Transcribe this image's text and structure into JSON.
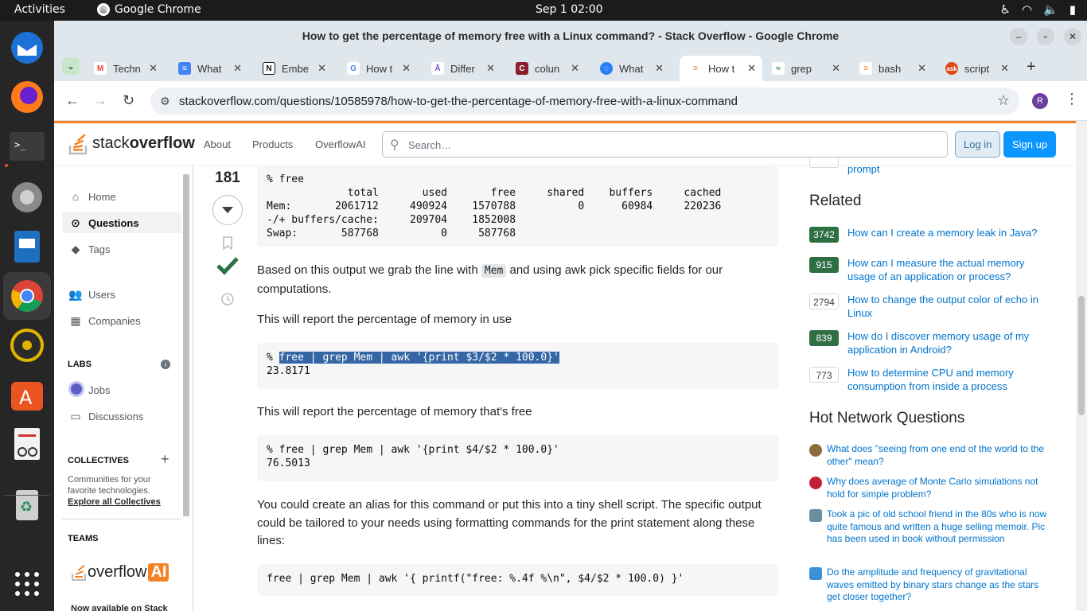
{
  "topbar": {
    "activities": "Activities",
    "app_name": "Google Chrome",
    "clock": "Sep 1  02:00"
  },
  "window": {
    "title": "How to get the percentage of memory free with a Linux command? - Stack Overflow - Google Chrome"
  },
  "tabs": [
    {
      "label": "Techn",
      "favicon": "gmail-icon",
      "color": "#ea4335"
    },
    {
      "label": "What",
      "favicon": "docs-icon",
      "color": "#4285f4"
    },
    {
      "label": "Embe",
      "favicon": "notion-icon",
      "color": "#111111"
    },
    {
      "label": "How t",
      "favicon": "google-icon",
      "color": "#4285f4"
    },
    {
      "label": "Differ",
      "favicon": "ask-ubuntu-icon",
      "color": "#6e56cf"
    },
    {
      "label": "colun",
      "favicon": "column-icon",
      "color": "#8b1d2c"
    },
    {
      "label": "What",
      "favicon": "search-icon",
      "color": "#2d7ff9"
    },
    {
      "label": "How t",
      "favicon": "stackoverflow-icon",
      "color": "#f48225",
      "active": true
    },
    {
      "label": "grep",
      "favicon": "grep-icon",
      "color": "#2e8b57"
    },
    {
      "label": "bash",
      "favicon": "stackoverflow-icon",
      "color": "#f48225"
    },
    {
      "label": "script",
      "favicon": "askubuntu-icon",
      "color": "#dd4814"
    }
  ],
  "address_bar": {
    "url": "stackoverflow.com/questions/10585978/how-to-get-the-percentage-of-memory-free-with-a-linux-command",
    "profile_initial": "R"
  },
  "so_header": {
    "logo_stack": "stack",
    "logo_overflow": "overflow",
    "nav": [
      "About",
      "Products",
      "OverflowAI"
    ],
    "search_placeholder": "Search…",
    "login": "Log in",
    "signup": "Sign up"
  },
  "left_nav": {
    "home": "Home",
    "questions": "Questions",
    "tags": "Tags",
    "users": "Users",
    "companies": "Companies",
    "labs_heading": "LABS",
    "jobs": "Jobs",
    "discussions": "Discussions",
    "collectives_heading": "COLLECTIVES",
    "collectives_desc": "Communities for your favorite technologies.",
    "collectives_link": "Explore all Collectives",
    "teams_heading": "TEAMS",
    "overflow_ai_a": "overflow",
    "overflow_ai_b": "AI",
    "now_available": "Now available on Stack"
  },
  "answer": {
    "score": "181",
    "code_free": "% free\n             total       used       free     shared    buffers     cached\nMem:       2061712     490924    1570788          0      60984     220236\n-/+ buffers/cache:     209704    1852008\nSwap:       587768          0     587768",
    "p1_a": "Based on this output we grab the line with ",
    "p1_code": "Mem",
    "p1_b": " and using awk pick specific fields for our computations.",
    "p2": "This will report the percentage of memory in use",
    "code2_prompt": "% ",
    "code2_cmd": "free | grep Mem | awk '{print $3/$2 * 100.0}'",
    "code2_out": "23.8171",
    "p3": "This will report the percentage of memory that's free",
    "code3": "% free | grep Mem | awk '{print $4/$2 * 100.0}'\n76.5013",
    "p4": "You could create an alias for this command or put this into a tiny shell script. The specific output could be tailored to your needs using formatting commands for the print statement along these lines:",
    "code4": "free | grep Mem | awk '{ printf(\"free: %.4f %\\n\", $4/$2 * 100.0) }'"
  },
  "right_sidebar": {
    "prompt_tail": "prompt",
    "related_heading": "Related",
    "related": [
      {
        "score": "3742",
        "title": "How can I create a memory leak in Java?",
        "accepted": true
      },
      {
        "score": "915",
        "title": "How can I measure the actual memory usage of an application or process?",
        "accepted": true
      },
      {
        "score": "2794",
        "title": "How to change the output color of echo in Linux",
        "accepted": false
      },
      {
        "score": "839",
        "title": "How do I discover memory usage of my application in Android?",
        "accepted": true
      },
      {
        "score": "773",
        "title": "How to determine CPU and memory consumption from inside a process",
        "accepted": false
      }
    ],
    "hnq_heading": "Hot Network Questions",
    "hnq": [
      {
        "title": "What does \"seeing from one end of the world to the other\" mean?",
        "icon_color": "#8a6d3b"
      },
      {
        "title": "Why does average of Monte Carlo simulations not hold for simple problem?",
        "icon_color": "#c21f3a"
      },
      {
        "title": "Took a pic of old school friend in the 80s who is now quite famous and written a huge selling memoir. Pic has been used in book without permission",
        "icon_color": "#6b8e9f"
      },
      {
        "title": "Do the amplitude and frequency of gravitational waves emitted by binary stars change as the stars get closer together?",
        "icon_color": "#3d8fd6"
      }
    ]
  }
}
